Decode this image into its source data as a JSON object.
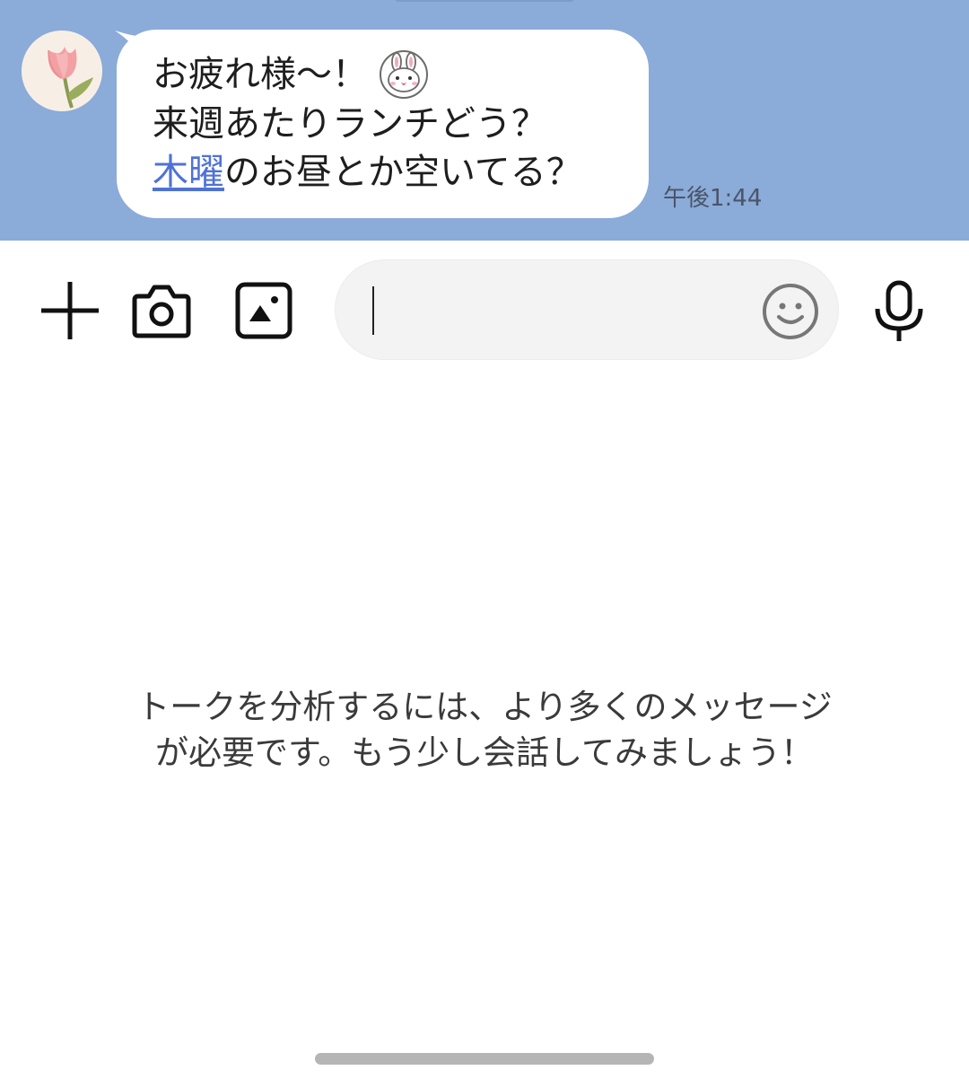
{
  "message": {
    "line1": "お疲れ様〜！",
    "line2": "来週あたりランチどう？",
    "line3_link": "木曜",
    "line3_rest": "のお昼とか空いてる？",
    "sticker_icon": "rabbit-face-icon",
    "timestamp": "午後1:44"
  },
  "avatar": {
    "icon": "tulip-icon"
  },
  "input_bar": {
    "input_value": "",
    "icons": [
      "plus-icon",
      "camera-icon",
      "image-icon",
      "smiley-icon",
      "microphone-icon"
    ]
  },
  "analysis_notice": {
    "line1": "トークを分析するには、より多くのメッセージ",
    "line2": "が必要です。もう少し会話してみましょう！"
  },
  "colors": {
    "chat_background": "#8babd9",
    "link": "#4f72d6",
    "input_field": "#f3f3f3"
  }
}
